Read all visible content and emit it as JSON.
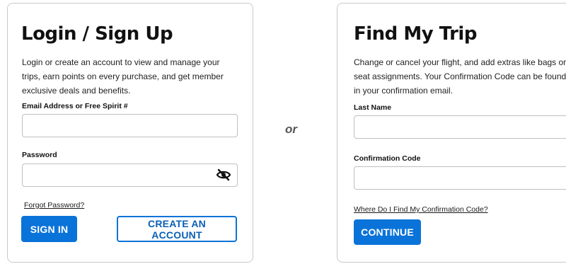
{
  "login": {
    "title": "Login / Sign Up",
    "description": "Login or create an account to view and manage your trips, earn points on every purchase, and get member exclusive deals and benefits.",
    "email_label": "Email Address or Free Spirit #",
    "email_value": "",
    "password_label": "Password",
    "password_value": "",
    "forgot_link": "Forgot Password?",
    "sign_in_button": "SIGN IN",
    "create_account_button": "CREATE AN ACCOUNT"
  },
  "separator": "or",
  "find_trip": {
    "title": "Find My Trip",
    "description": "Change or cancel your flight, and add extras like bags or seat assignments. Your Confirmation Code can be found in your confirmation email.",
    "last_name_label": "Last Name",
    "last_name_value": "",
    "confirmation_label": "Confirmation Code",
    "confirmation_value": "",
    "help_link": "Where Do I Find My Confirmation Code?",
    "continue_button": "CONTINUE"
  },
  "icons": {
    "password_toggle": "eye-slash-icon"
  },
  "colors": {
    "primary": "#0a73d9",
    "card_border": "#c9c9c9"
  }
}
